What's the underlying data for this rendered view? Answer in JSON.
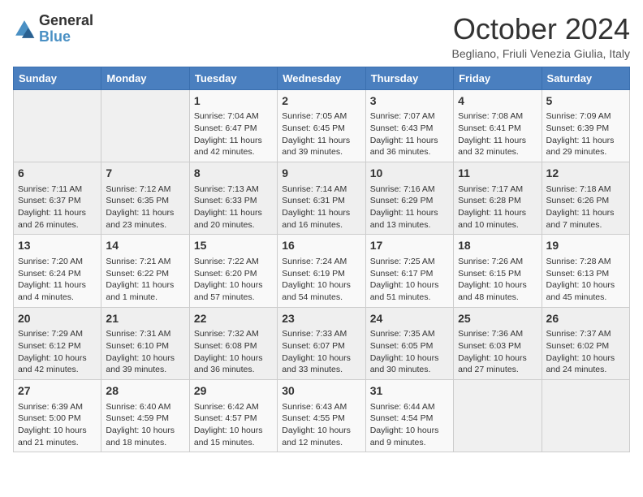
{
  "logo": {
    "line1": "General",
    "line2": "Blue"
  },
  "title": "October 2024",
  "location": "Begliano, Friuli Venezia Giulia, Italy",
  "days_of_week": [
    "Sunday",
    "Monday",
    "Tuesday",
    "Wednesday",
    "Thursday",
    "Friday",
    "Saturday"
  ],
  "weeks": [
    [
      {
        "day": "",
        "data": ""
      },
      {
        "day": "",
        "data": ""
      },
      {
        "day": "1",
        "sunrise": "Sunrise: 7:04 AM",
        "sunset": "Sunset: 6:47 PM",
        "daylight": "Daylight: 11 hours and 42 minutes."
      },
      {
        "day": "2",
        "sunrise": "Sunrise: 7:05 AM",
        "sunset": "Sunset: 6:45 PM",
        "daylight": "Daylight: 11 hours and 39 minutes."
      },
      {
        "day": "3",
        "sunrise": "Sunrise: 7:07 AM",
        "sunset": "Sunset: 6:43 PM",
        "daylight": "Daylight: 11 hours and 36 minutes."
      },
      {
        "day": "4",
        "sunrise": "Sunrise: 7:08 AM",
        "sunset": "Sunset: 6:41 PM",
        "daylight": "Daylight: 11 hours and 32 minutes."
      },
      {
        "day": "5",
        "sunrise": "Sunrise: 7:09 AM",
        "sunset": "Sunset: 6:39 PM",
        "daylight": "Daylight: 11 hours and 29 minutes."
      }
    ],
    [
      {
        "day": "6",
        "sunrise": "Sunrise: 7:11 AM",
        "sunset": "Sunset: 6:37 PM",
        "daylight": "Daylight: 11 hours and 26 minutes."
      },
      {
        "day": "7",
        "sunrise": "Sunrise: 7:12 AM",
        "sunset": "Sunset: 6:35 PM",
        "daylight": "Daylight: 11 hours and 23 minutes."
      },
      {
        "day": "8",
        "sunrise": "Sunrise: 7:13 AM",
        "sunset": "Sunset: 6:33 PM",
        "daylight": "Daylight: 11 hours and 20 minutes."
      },
      {
        "day": "9",
        "sunrise": "Sunrise: 7:14 AM",
        "sunset": "Sunset: 6:31 PM",
        "daylight": "Daylight: 11 hours and 16 minutes."
      },
      {
        "day": "10",
        "sunrise": "Sunrise: 7:16 AM",
        "sunset": "Sunset: 6:29 PM",
        "daylight": "Daylight: 11 hours and 13 minutes."
      },
      {
        "day": "11",
        "sunrise": "Sunrise: 7:17 AM",
        "sunset": "Sunset: 6:28 PM",
        "daylight": "Daylight: 11 hours and 10 minutes."
      },
      {
        "day": "12",
        "sunrise": "Sunrise: 7:18 AM",
        "sunset": "Sunset: 6:26 PM",
        "daylight": "Daylight: 11 hours and 7 minutes."
      }
    ],
    [
      {
        "day": "13",
        "sunrise": "Sunrise: 7:20 AM",
        "sunset": "Sunset: 6:24 PM",
        "daylight": "Daylight: 11 hours and 4 minutes."
      },
      {
        "day": "14",
        "sunrise": "Sunrise: 7:21 AM",
        "sunset": "Sunset: 6:22 PM",
        "daylight": "Daylight: 11 hours and 1 minute."
      },
      {
        "day": "15",
        "sunrise": "Sunrise: 7:22 AM",
        "sunset": "Sunset: 6:20 PM",
        "daylight": "Daylight: 10 hours and 57 minutes."
      },
      {
        "day": "16",
        "sunrise": "Sunrise: 7:24 AM",
        "sunset": "Sunset: 6:19 PM",
        "daylight": "Daylight: 10 hours and 54 minutes."
      },
      {
        "day": "17",
        "sunrise": "Sunrise: 7:25 AM",
        "sunset": "Sunset: 6:17 PM",
        "daylight": "Daylight: 10 hours and 51 minutes."
      },
      {
        "day": "18",
        "sunrise": "Sunrise: 7:26 AM",
        "sunset": "Sunset: 6:15 PM",
        "daylight": "Daylight: 10 hours and 48 minutes."
      },
      {
        "day": "19",
        "sunrise": "Sunrise: 7:28 AM",
        "sunset": "Sunset: 6:13 PM",
        "daylight": "Daylight: 10 hours and 45 minutes."
      }
    ],
    [
      {
        "day": "20",
        "sunrise": "Sunrise: 7:29 AM",
        "sunset": "Sunset: 6:12 PM",
        "daylight": "Daylight: 10 hours and 42 minutes."
      },
      {
        "day": "21",
        "sunrise": "Sunrise: 7:31 AM",
        "sunset": "Sunset: 6:10 PM",
        "daylight": "Daylight: 10 hours and 39 minutes."
      },
      {
        "day": "22",
        "sunrise": "Sunrise: 7:32 AM",
        "sunset": "Sunset: 6:08 PM",
        "daylight": "Daylight: 10 hours and 36 minutes."
      },
      {
        "day": "23",
        "sunrise": "Sunrise: 7:33 AM",
        "sunset": "Sunset: 6:07 PM",
        "daylight": "Daylight: 10 hours and 33 minutes."
      },
      {
        "day": "24",
        "sunrise": "Sunrise: 7:35 AM",
        "sunset": "Sunset: 6:05 PM",
        "daylight": "Daylight: 10 hours and 30 minutes."
      },
      {
        "day": "25",
        "sunrise": "Sunrise: 7:36 AM",
        "sunset": "Sunset: 6:03 PM",
        "daylight": "Daylight: 10 hours and 27 minutes."
      },
      {
        "day": "26",
        "sunrise": "Sunrise: 7:37 AM",
        "sunset": "Sunset: 6:02 PM",
        "daylight": "Daylight: 10 hours and 24 minutes."
      }
    ],
    [
      {
        "day": "27",
        "sunrise": "Sunrise: 6:39 AM",
        "sunset": "Sunset: 5:00 PM",
        "daylight": "Daylight: 10 hours and 21 minutes."
      },
      {
        "day": "28",
        "sunrise": "Sunrise: 6:40 AM",
        "sunset": "Sunset: 4:59 PM",
        "daylight": "Daylight: 10 hours and 18 minutes."
      },
      {
        "day": "29",
        "sunrise": "Sunrise: 6:42 AM",
        "sunset": "Sunset: 4:57 PM",
        "daylight": "Daylight: 10 hours and 15 minutes."
      },
      {
        "day": "30",
        "sunrise": "Sunrise: 6:43 AM",
        "sunset": "Sunset: 4:55 PM",
        "daylight": "Daylight: 10 hours and 12 minutes."
      },
      {
        "day": "31",
        "sunrise": "Sunrise: 6:44 AM",
        "sunset": "Sunset: 4:54 PM",
        "daylight": "Daylight: 10 hours and 9 minutes."
      },
      {
        "day": "",
        "data": ""
      },
      {
        "day": "",
        "data": ""
      }
    ]
  ]
}
